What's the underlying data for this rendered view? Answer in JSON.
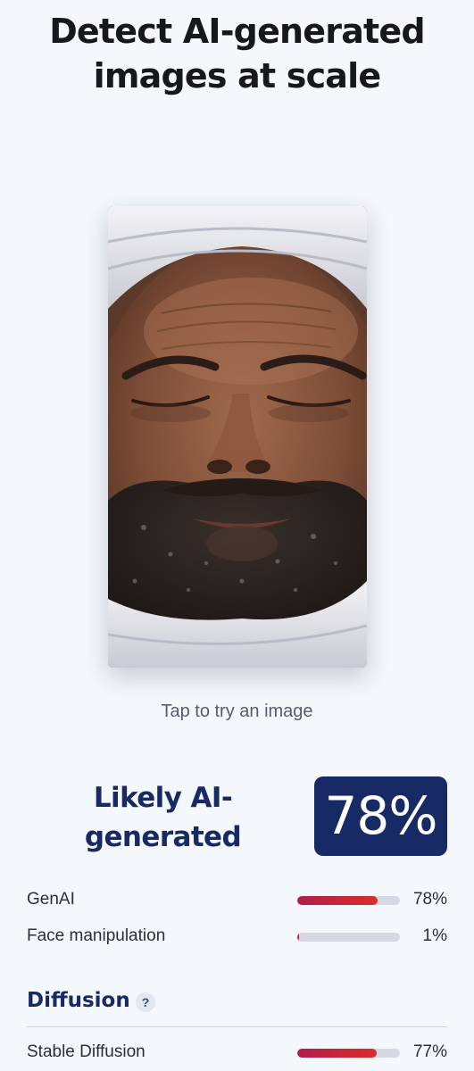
{
  "header": {
    "line1": "Detect AI-generated",
    "line2": "images at scale"
  },
  "demo": {
    "tap_hint": "Tap to try an image"
  },
  "result": {
    "verdict_line1": "Likely AI-",
    "verdict_line2": "generated",
    "score": "78%"
  },
  "metrics": [
    {
      "label": "GenAI",
      "value": "78%",
      "fraction": 0.78
    },
    {
      "label": "Face manipulation",
      "value": "1%",
      "fraction": 0.01
    }
  ],
  "diffusion": {
    "title": "Diffusion",
    "help": "?",
    "items": [
      {
        "label": "Stable Diffusion",
        "value": "77%",
        "fraction": 0.77
      }
    ]
  },
  "colors": {
    "navy": "#172a66",
    "bar_start": "#b01e48",
    "bar_end": "#d92e2a",
    "track": "#d4d9e3",
    "background": "#f4f7fb"
  }
}
